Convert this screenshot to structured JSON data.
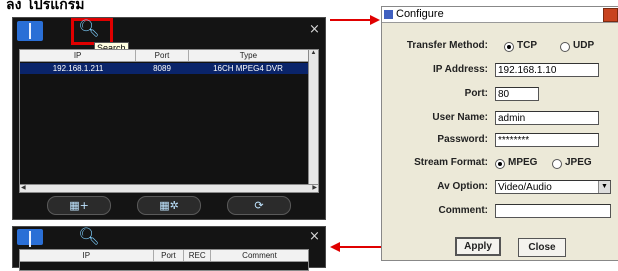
{
  "heading": "ลง โปรแกรม",
  "device_list": {
    "close_glyph": "×",
    "tooltip": "Search",
    "columns": [
      "IP",
      "Port",
      "Type"
    ],
    "rows": [
      {
        "ip": "192.168.1.211",
        "port": "8089",
        "type": "16CH MPEG4 DVR"
      }
    ],
    "toolbar_icons": [
      "address-book-icon",
      "search-icon"
    ],
    "bottom_buttons": [
      {
        "icon": "add-device-icon",
        "glyph": "▦+"
      },
      {
        "icon": "device-settings-icon",
        "glyph": "▦✲"
      },
      {
        "icon": "refresh-icon",
        "glyph": "⟳"
      }
    ]
  },
  "device_list_2": {
    "close_glyph": "×",
    "columns": [
      "IP",
      "Port",
      "REC",
      "Comment"
    ]
  },
  "configure": {
    "title": "Configure",
    "transfer_method_label": "Transfer Method:",
    "tcp_label": "TCP",
    "udp_label": "UDP",
    "transfer_selected": "TCP",
    "ip_label": "IP Address:",
    "ip_value": "192.168.1.10",
    "port_label": "Port:",
    "port_value": "80",
    "username_label": "User Name:",
    "username_value": "admin",
    "password_label": "Password:",
    "password_value": "********",
    "stream_format_label": "Stream Format:",
    "mpeg_label": "MPEG",
    "jpeg_label": "JPEG",
    "stream_selected": "MPEG",
    "av_option_label": "Av Option:",
    "av_option_value": "Video/Audio",
    "comment_label": "Comment:",
    "comment_value": "",
    "apply_label": "Apply",
    "close_label": "Close"
  },
  "colors": {
    "highlight": "#e00000",
    "window_bg": "#141414",
    "selection": "#0a246a",
    "dialog_bg": "#ece9d8"
  }
}
